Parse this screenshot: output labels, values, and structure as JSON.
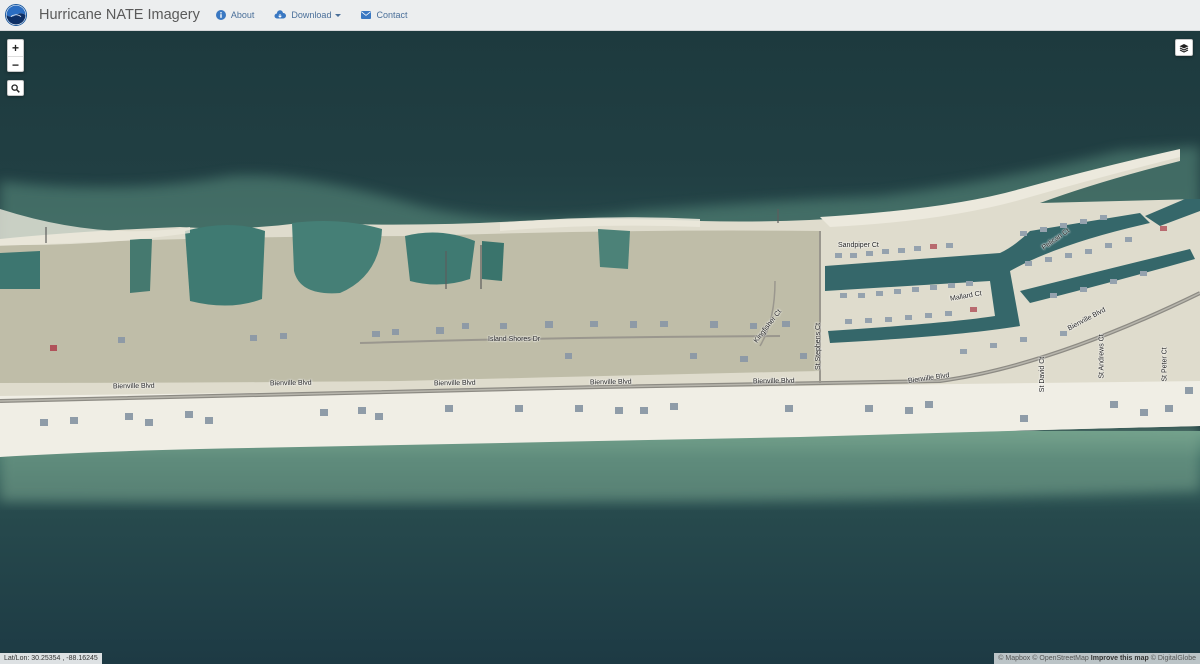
{
  "navbar": {
    "logo": "noaa-logo",
    "title": "Hurricane NATE Imagery",
    "about": "About",
    "download": "Download",
    "contact": "Contact"
  },
  "map": {
    "zoom_in": "+",
    "zoom_out": "−",
    "streets": {
      "bienville": "Bienville Blvd",
      "island_shores": "Island Shores Dr",
      "sandpiper": "Sandpiper Ct",
      "mallard": "Mallard Ct",
      "pelican": "Pelican Ct",
      "st_stephens": "St Stephens Ct",
      "kingfisher": "Kingfisher Ct",
      "st_david": "St David Ct",
      "st_andrews": "St Andrews Ct",
      "st_peter": "St Peter Ct"
    },
    "coords_label": "Lat/Lon: 30.25354 , -88.16245",
    "attribution": {
      "copy": "© Mapbox",
      "osm": "© OpenStreetMap",
      "improve": "Improve this map",
      "dg": "© DigitalGlobe"
    },
    "colors": {
      "water_deep": "#1e3c40",
      "water_shallow": "#5a8f86",
      "sand": "#efece2",
      "vegetation": "#a9aa93",
      "pond": "#3d7a73"
    }
  }
}
